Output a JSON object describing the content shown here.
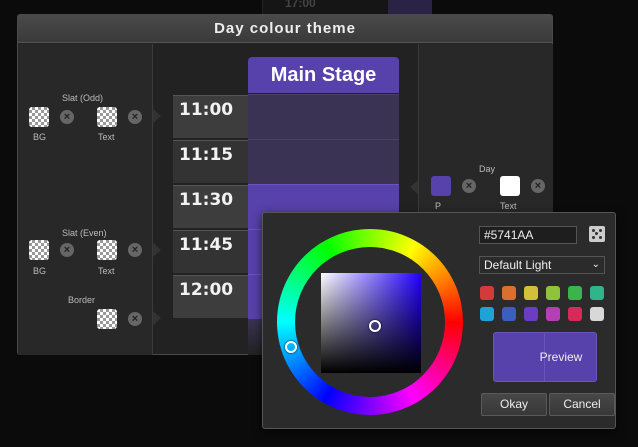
{
  "background": {
    "time": "17:00"
  },
  "dialog": {
    "title": "Day colour theme"
  },
  "left": {
    "slat_odd": {
      "label": "Slat (Odd)",
      "bg_label": "BG",
      "text_label": "Text"
    },
    "slat_even": {
      "label": "Slat (Even)",
      "bg_label": "BG",
      "text_label": "Text"
    },
    "border": {
      "label": "Border"
    }
  },
  "times": [
    "11:00",
    "11:15",
    "11:30",
    "11:45",
    "12:00"
  ],
  "stage": {
    "name": "Main Stage"
  },
  "right": {
    "day": {
      "label": "Day",
      "bg_label": "P",
      "text_label": "Text",
      "bg_color": "#5741AA",
      "text_color": "#ffffff"
    }
  },
  "picker": {
    "hex_value": "#5741AA",
    "theme": "Default Light",
    "palette": [
      "#d13b3b",
      "#d9702f",
      "#d2c03a",
      "#8dc43b",
      "#39b54a",
      "#2fb58a",
      "#1fa2d8",
      "#3b5fbf",
      "#6b3cc4",
      "#b53fb5",
      "#d82a5a",
      "#d8d8d8"
    ],
    "preview_label": "Preview",
    "okay_label": "Okay",
    "cancel_label": "Cancel"
  },
  "colors": {
    "accent": "#5741AA",
    "cell_inactive": "#3b3353"
  }
}
